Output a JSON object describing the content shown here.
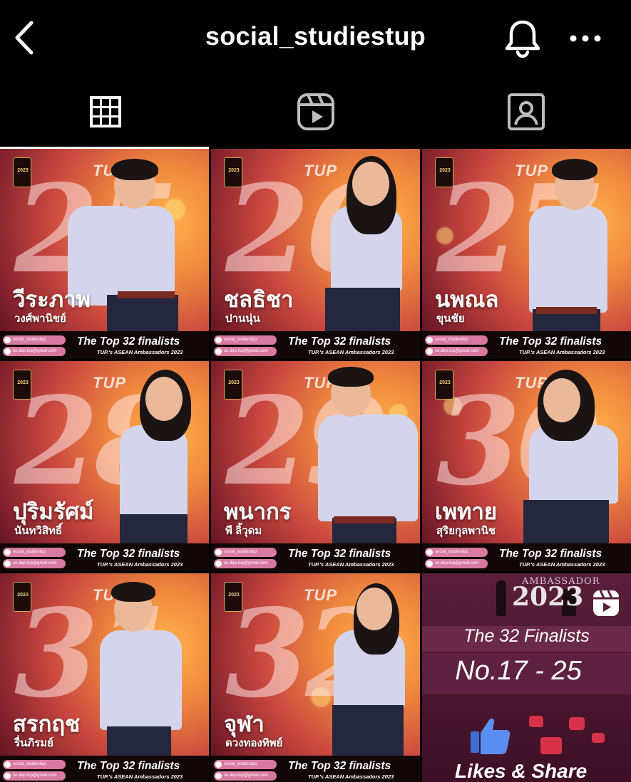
{
  "header": {
    "title": "social_studiestup"
  },
  "tabs": [
    {
      "id": "grid",
      "icon": "grid-icon",
      "active": true
    },
    {
      "id": "reels",
      "icon": "reels-icon",
      "active": false
    },
    {
      "id": "tagged",
      "icon": "tagged-icon",
      "active": false
    }
  ],
  "posts": [
    {
      "number": "25",
      "name": "วีระภาพ",
      "surname": "วงศ์พานิชย์",
      "caption": "The Top 32 finalists",
      "subcaption": "TUP.'s ASEAN Ambassadors 2023",
      "brand": "TUP",
      "chip_1": "social_studiestup",
      "chip_2": "so.dep.tup@gmail.com"
    },
    {
      "number": "26",
      "name": "ชลธิชา",
      "surname": "ปานนุ่น",
      "caption": "The Top 32 finalists",
      "subcaption": "TUP.'s ASEAN Ambassadors 2023",
      "brand": "TUP",
      "chip_1": "social_studiestup",
      "chip_2": "so.dep.tup@gmail.com"
    },
    {
      "number": "27",
      "name": "นพณล",
      "surname": "ขุนชัย",
      "caption": "The Top 32 finalists",
      "subcaption": "TUP.'s ASEAN Ambassadors 2023",
      "brand": "TUP",
      "chip_1": "social_studiestup",
      "chip_2": "so.dep.tup@gmail.com"
    },
    {
      "number": "28",
      "name": "ปุริมรัศม์",
      "surname": "นันทวิสิทธิ์",
      "caption": "The Top 32 finalists",
      "subcaption": "TUP.'s ASEAN Ambassadors 2023",
      "brand": "TUP",
      "chip_1": "social_studiestup",
      "chip_2": "so.dep.tup@gmail.com"
    },
    {
      "number": "29",
      "name": "พนากร",
      "surname": "พี ลิ้วุดม",
      "caption": "The Top 32 finalists",
      "subcaption": "TUP.'s ASEAN Ambassadors 2023",
      "brand": "TUP",
      "chip_1": "social_studiestup",
      "chip_2": "so.dep.tup@gmail.com"
    },
    {
      "number": "30",
      "name": "เพทาย",
      "surname": "สุริยกุลพานิช",
      "caption": "The Top 32 finalists",
      "subcaption": "TUP.'s ASEAN Ambassadors 2023",
      "brand": "TUP",
      "chip_1": "social_studiestup",
      "chip_2": "so.dep.tup@gmail.com"
    },
    {
      "number": "31",
      "name": "สรกฤช",
      "surname": "รื่นภิรมย์",
      "caption": "The Top 32 finalists",
      "subcaption": "TUP.'s ASEAN Ambassadors 2023",
      "brand": "TUP",
      "chip_1": "social_studiestup",
      "chip_2": "so.dep.tup@gmail.com"
    },
    {
      "number": "32",
      "name": "จุฬา",
      "surname": "ดวงทองทิพย์",
      "caption": "The Top 32 finalists",
      "subcaption": "TUP.'s ASEAN Ambassadors 2023",
      "brand": "TUP",
      "chip_1": "social_studiestup",
      "chip_2": "so.dep.tup@gmail.com"
    }
  ],
  "reel_post": {
    "ambassador": "AMBASSADOR",
    "year": "2023",
    "finalists": "The 32 Finalists",
    "range": "No.17 - 25",
    "cta": "Likes & Share"
  },
  "colors": {
    "background": "#000000",
    "text": "#ffffff",
    "tile_orange": "#f08a3e",
    "tile_crimson": "#c9473f",
    "reel_purple": "#5a1f3a"
  }
}
